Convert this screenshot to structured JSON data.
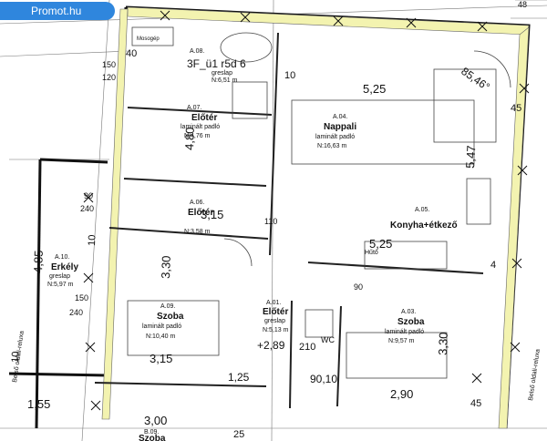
{
  "badge": {
    "label": "Promot.hu"
  },
  "floor_label": "3F_ü1 r5d 6",
  "top_right": "48",
  "angle": "85,46°",
  "rooms": [
    {
      "code": "A.08.",
      "name": "Mosogép",
      "floor": "greslap",
      "area": "N:6,51 m"
    },
    {
      "code": "A.04.",
      "name": "Nappali",
      "floor": "laminált padló",
      "area": "N:16,63 m"
    },
    {
      "code": "A.07.",
      "name": "Előtér",
      "floor": "laminált padló",
      "area": "N:4,76 m"
    },
    {
      "code": "A.06.",
      "name": "Előtér",
      "floor": "",
      "area": "N:3,58 m"
    },
    {
      "code": "A.05.",
      "name": "Konyha+étkező",
      "floor": "",
      "area": ""
    },
    {
      "code": "A.10.",
      "name": "Erkély",
      "floor": "greslap",
      "area": "N:5,97 m"
    },
    {
      "code": "A.09.",
      "name": "Szoba",
      "floor": "laminált padló",
      "area": "N:10,40 m"
    },
    {
      "code": "A.01.",
      "name": "Előtér",
      "floor": "greslap",
      "area": "N:5,13 m"
    },
    {
      "code": "A.03.",
      "name": "Szoba",
      "floor": "laminált padló",
      "area": "N:9,57 m"
    },
    {
      "code": "B.09.",
      "name": "Szoba",
      "floor": "",
      "area": ""
    }
  ],
  "dims": {
    "d525_top": "5,25",
    "d547": "5,47",
    "d45": "45",
    "d480": "4,80",
    "d315a": "3,15",
    "d525b": "5,25",
    "d485": "4,85",
    "d330a": "3,30",
    "d330b": "3,30",
    "d315b": "3,15",
    "d289": "+2,89",
    "d210": "210",
    "d125": "1,25",
    "d9010": "90,10",
    "d290": "2,90",
    "d155": "1,55",
    "d300": "3,00",
    "d150a": "150",
    "d120": "120",
    "d40a": "40",
    "d90a": "90",
    "d240a": "240",
    "d10a": "10",
    "d110": "110",
    "d150b": "150",
    "d240b": "240",
    "d90b": "90",
    "d10b": "10",
    "d25": "25",
    "d45b": "45",
    "d4": "4",
    "d10c": "10"
  },
  "notes": {
    "side_left": "Belső oldali-reluxa",
    "side_right": "Belső oldali-reluxa",
    "hutő": "Hűtő",
    "wc": "WC"
  }
}
